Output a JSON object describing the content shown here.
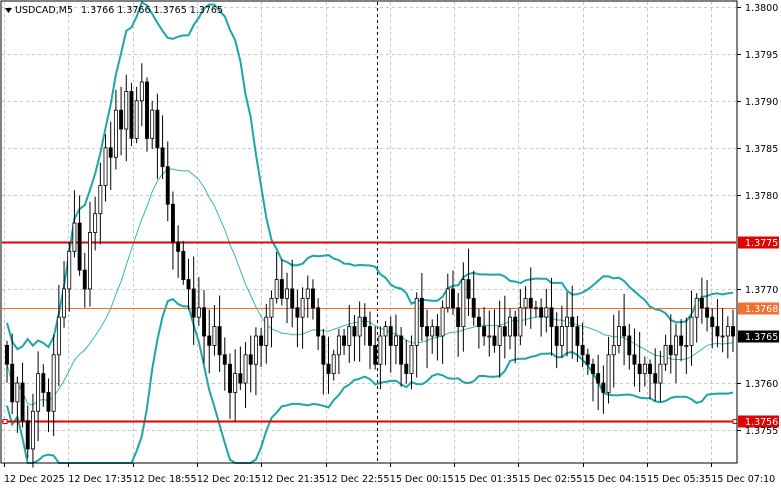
{
  "header": {
    "menu_icon": "triangle-down-icon",
    "symbol": "USDCAD,M5",
    "ohlc": "1.3766 1.3766 1.3765 1.3765"
  },
  "colors": {
    "background": "#ffffff",
    "grid": "#c8c8c8",
    "candle": "#000000",
    "bollinger": "#1fa5a5",
    "moving_average": "#3cb4b4",
    "level_red": "#e00000",
    "level_orange": "#f07030",
    "price_tag_current": "#000000",
    "crosshair": "#000000"
  },
  "chart_data": {
    "type": "candlestick",
    "symbol": "USDCAD",
    "timeframe": "M5",
    "ylim": [
      1.37515,
      1.38005
    ],
    "y_ticks": [
      "1.3800",
      "1.3795",
      "1.3790",
      "1.3785",
      "1.3780",
      "1.3770",
      "1.3760",
      "1.3755"
    ],
    "x_labels": [
      "12 Dec 2025",
      "12 Dec 17:35",
      "12 Dec 18:55",
      "12 Dec 20:15",
      "12 Dec 21:35",
      "12 Dec 22:55",
      "15 Dec 00:15",
      "15 Dec 01:35",
      "15 Dec 02:55",
      "15 Dec 04:15",
      "15 Dec 05:35",
      "15 Dec 07:10"
    ],
    "levels": [
      {
        "label": "1.3775",
        "value": 1.3775,
        "color": "#e00000",
        "style": "resistance"
      },
      {
        "label": "1.3768",
        "value": 1.3768,
        "color": "#f07030",
        "style": "pivot"
      },
      {
        "label": "1.3756",
        "value": 1.3756,
        "color": "#e00000",
        "style": "support"
      }
    ],
    "current_price": {
      "label": "1.3765",
      "value": 1.3765
    },
    "separator_after_label": "12 Dec 22:55",
    "closes": [
      1.3762,
      1.3758,
      1.376,
      1.3756,
      1.3753,
      1.3757,
      1.3761,
      1.3759,
      1.3757,
      1.3763,
      1.3767,
      1.377,
      1.3774,
      1.3777,
      1.3772,
      1.377,
      1.3776,
      1.3778,
      1.3781,
      1.3785,
      1.3784,
      1.3789,
      1.3787,
      1.3791,
      1.3786,
      1.379,
      1.3792,
      1.3786,
      1.3789,
      1.3785,
      1.3783,
      1.3779,
      1.3775,
      1.3774,
      1.3771,
      1.377,
      1.3767,
      1.3768,
      1.3765,
      1.3764,
      1.3766,
      1.3763,
      1.3762,
      1.3759,
      1.3761,
      1.376,
      1.3763,
      1.3762,
      1.3765,
      1.3764,
      1.3767,
      1.3769,
      1.3771,
      1.3769,
      1.377,
      1.3768,
      1.3767,
      1.3769,
      1.377,
      1.3768,
      1.3765,
      1.3762,
      1.3761,
      1.3763,
      1.3765,
      1.3764,
      1.3766,
      1.3765,
      1.3767,
      1.3766,
      1.3764,
      1.3762,
      1.3765,
      1.3766,
      1.3764,
      1.3765,
      1.3762,
      1.3761,
      1.3764,
      1.3769,
      1.3766,
      1.3765,
      1.3766,
      1.3765,
      1.3768,
      1.377,
      1.3768,
      1.3766,
      1.3771,
      1.3769,
      1.3767,
      1.3766,
      1.3765,
      1.3765,
      1.3764,
      1.3766,
      1.3765,
      1.3767,
      1.3765,
      1.3768,
      1.3769,
      1.3768,
      1.3768,
      1.3767,
      1.3768,
      1.3766,
      1.3764,
      1.3766,
      1.3767,
      1.3766,
      1.3764,
      1.3763,
      1.3762,
      1.3761,
      1.376,
      1.3759,
      1.3763,
      1.3764,
      1.3766,
      1.3765,
      1.3763,
      1.3762,
      1.3761,
      1.3762,
      1.3761,
      1.376,
      1.3762,
      1.3764,
      1.3763,
      1.3765,
      1.3764,
      1.3764,
      1.3767,
      1.3769,
      1.3768,
      1.3767,
      1.3766,
      1.3765,
      1.3765,
      1.3766,
      1.3765
    ]
  }
}
